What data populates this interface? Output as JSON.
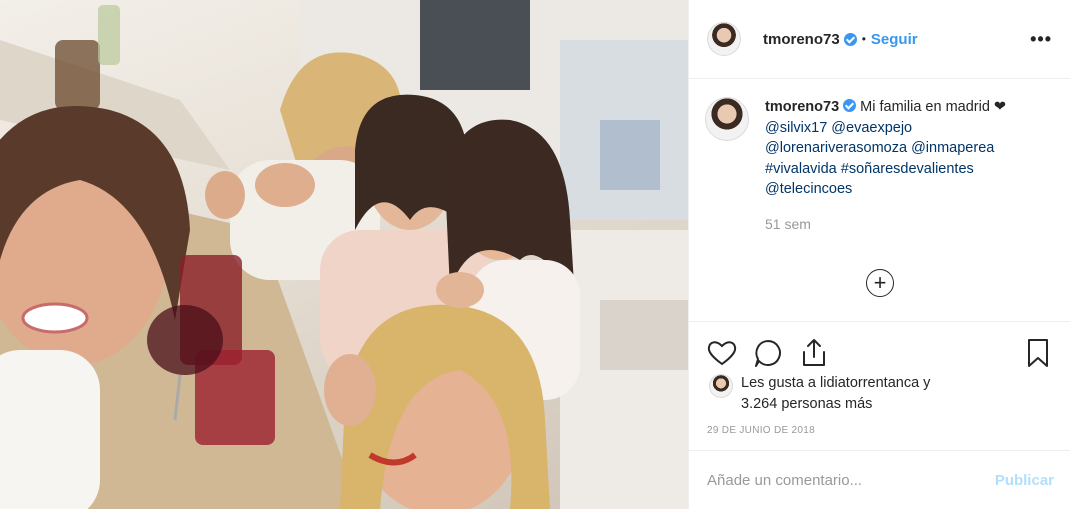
{
  "post": {
    "image_alt": "Selfie de cinco mujeres sentadas a una mesa de restaurante"
  },
  "header": {
    "username": "tmoreno73",
    "separator": "•",
    "follow_label": "Seguir",
    "more_label": "•••"
  },
  "caption": {
    "username": "tmoreno73",
    "text": "Mi familia en madrid ❤",
    "mentions_line1": "@silvix17 @evaexpejo",
    "mentions_line2": "@lorenariverasomoza @inmaperea",
    "hashtags": "#vivalavida #soñaresdevalientes",
    "mention_last": "@telecincoes",
    "time_ago": "51 sem"
  },
  "load_more_label": "+",
  "likes": {
    "line1": "Les gusta a lidiatorrentanca y",
    "line2": "3.264 personas más"
  },
  "date": "29 DE JUNIO DE 2018",
  "comment": {
    "placeholder": "Añade un comentario...",
    "publish_label": "Publicar"
  },
  "colors": {
    "accent": "#3897f0",
    "link": "#003569",
    "muted": "#999999",
    "publish_disabled": "#b2dffc"
  },
  "icons": [
    "verified-badge-icon",
    "more-options-icon",
    "heart-icon",
    "comment-icon",
    "share-icon",
    "bookmark-icon",
    "plus-circle-icon"
  ]
}
